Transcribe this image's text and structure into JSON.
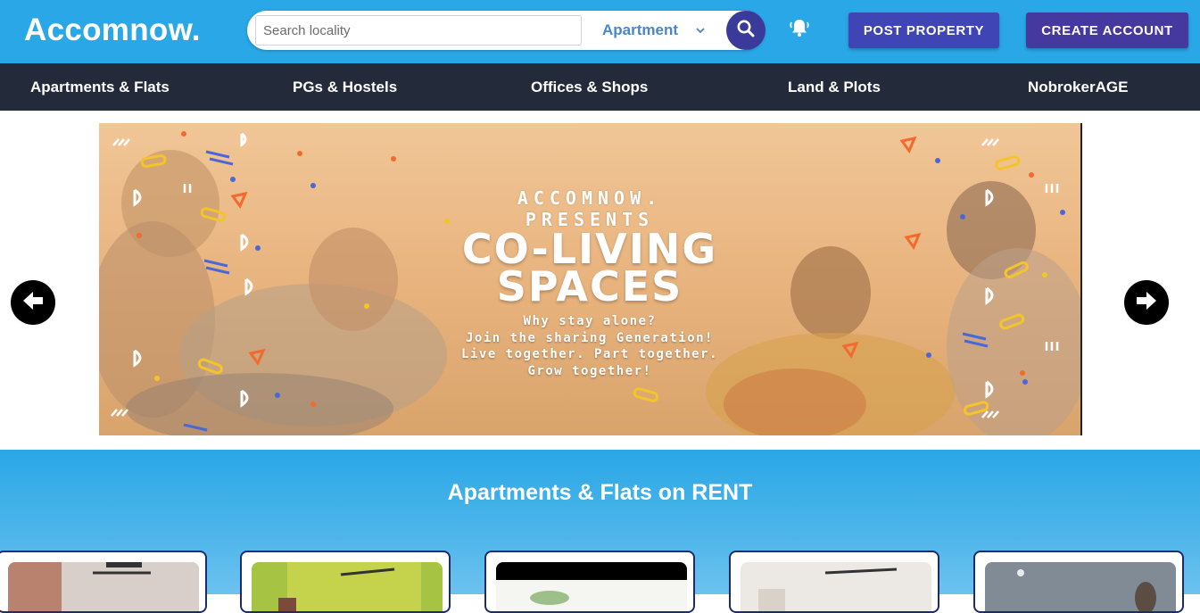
{
  "header": {
    "logo": "Accomnow.",
    "search": {
      "placeholder": "Search locality",
      "value": ""
    },
    "property_type": {
      "selected": "Apartment"
    },
    "post_property_label": "POST PROPERTY",
    "create_account_label": "CREATE ACCOUNT"
  },
  "nav": {
    "items": [
      {
        "label": "Apartments & Flats"
      },
      {
        "label": "PGs & Hostels"
      },
      {
        "label": "Offices & Shops"
      },
      {
        "label": "Land & Plots"
      },
      {
        "label": "NobrokerAGE"
      }
    ]
  },
  "carousel": {
    "slide": {
      "brand_line1": "ACCOMNOW.",
      "brand_line2": "PRESENTS",
      "title_line1": "CO-LIVING",
      "title_line2": "SPACES",
      "tag_line1": "Why stay alone?",
      "tag_line2": "Join the sharing Generation!",
      "tag_line3": "Live together. Part together.",
      "tag_line4": "Grow together!"
    }
  },
  "listing": {
    "title": "Apartments & Flats on RENT"
  },
  "colors": {
    "header_bg": "#2aa7e6",
    "nav_bg": "#232b3a",
    "post_button": "#3f45b5",
    "create_button": "#45389e",
    "search_button": "#3a3a9a"
  },
  "icons": {
    "search": "search-icon",
    "dropdown": "chevron-down-icon",
    "notification": "bell-icon",
    "prev": "arrow-left-icon",
    "next": "arrow-right-icon"
  }
}
